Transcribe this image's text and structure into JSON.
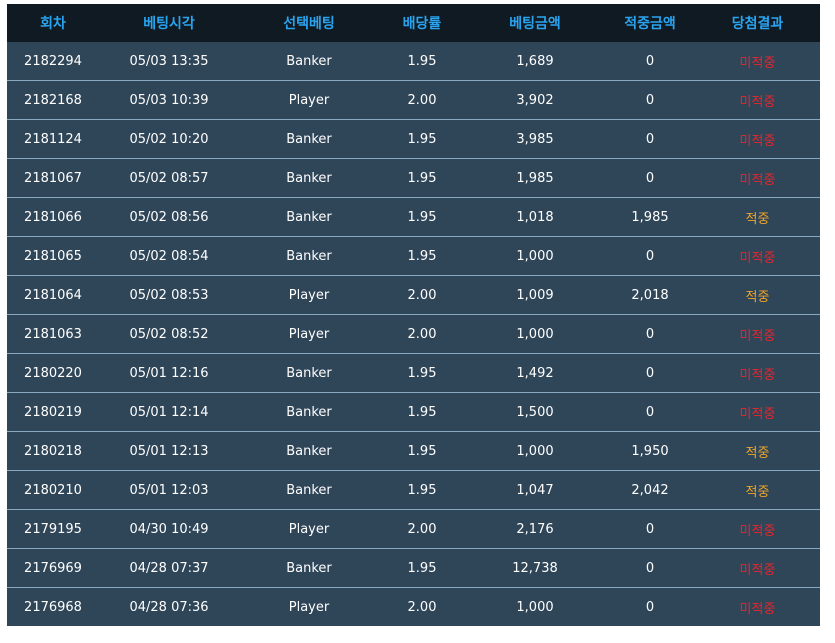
{
  "colors": {
    "header_bg": "#0f1a22",
    "header_text": "#2aa4f0",
    "row_bg": "#2f4558",
    "row_divider": "#88a8c0",
    "text": "#ffffff",
    "loss": "#e8262d",
    "win": "#f0a528"
  },
  "table": {
    "headers": [
      "회차",
      "베팅시각",
      "선택베팅",
      "배당률",
      "베팅금액",
      "적중금액",
      "당첨결과"
    ],
    "rows": [
      {
        "round": "2182294",
        "time": "05/03 13:35",
        "pick": "Banker",
        "odds": "1.95",
        "bet": "1,689",
        "win": "0",
        "result": "미적중",
        "status": "loss"
      },
      {
        "round": "2182168",
        "time": "05/03 10:39",
        "pick": "Player",
        "odds": "2.00",
        "bet": "3,902",
        "win": "0",
        "result": "미적중",
        "status": "loss"
      },
      {
        "round": "2181124",
        "time": "05/02 10:20",
        "pick": "Banker",
        "odds": "1.95",
        "bet": "3,985",
        "win": "0",
        "result": "미적중",
        "status": "loss"
      },
      {
        "round": "2181067",
        "time": "05/02 08:57",
        "pick": "Banker",
        "odds": "1.95",
        "bet": "1,985",
        "win": "0",
        "result": "미적중",
        "status": "loss"
      },
      {
        "round": "2181066",
        "time": "05/02 08:56",
        "pick": "Banker",
        "odds": "1.95",
        "bet": "1,018",
        "win": "1,985",
        "result": "적중",
        "status": "win"
      },
      {
        "round": "2181065",
        "time": "05/02 08:54",
        "pick": "Banker",
        "odds": "1.95",
        "bet": "1,000",
        "win": "0",
        "result": "미적중",
        "status": "loss"
      },
      {
        "round": "2181064",
        "time": "05/02 08:53",
        "pick": "Player",
        "odds": "2.00",
        "bet": "1,009",
        "win": "2,018",
        "result": "적중",
        "status": "win"
      },
      {
        "round": "2181063",
        "time": "05/02 08:52",
        "pick": "Player",
        "odds": "2.00",
        "bet": "1,000",
        "win": "0",
        "result": "미적중",
        "status": "loss"
      },
      {
        "round": "2180220",
        "time": "05/01 12:16",
        "pick": "Banker",
        "odds": "1.95",
        "bet": "1,492",
        "win": "0",
        "result": "미적중",
        "status": "loss"
      },
      {
        "round": "2180219",
        "time": "05/01 12:14",
        "pick": "Banker",
        "odds": "1.95",
        "bet": "1,500",
        "win": "0",
        "result": "미적중",
        "status": "loss"
      },
      {
        "round": "2180218",
        "time": "05/01 12:13",
        "pick": "Banker",
        "odds": "1.95",
        "bet": "1,000",
        "win": "1,950",
        "result": "적중",
        "status": "win"
      },
      {
        "round": "2180210",
        "time": "05/01 12:03",
        "pick": "Banker",
        "odds": "1.95",
        "bet": "1,047",
        "win": "2,042",
        "result": "적중",
        "status": "win"
      },
      {
        "round": "2179195",
        "time": "04/30 10:49",
        "pick": "Player",
        "odds": "2.00",
        "bet": "2,176",
        "win": "0",
        "result": "미적중",
        "status": "loss"
      },
      {
        "round": "2176969",
        "time": "04/28 07:37",
        "pick": "Banker",
        "odds": "1.95",
        "bet": "12,738",
        "win": "0",
        "result": "미적중",
        "status": "loss"
      },
      {
        "round": "2176968",
        "time": "04/28 07:36",
        "pick": "Player",
        "odds": "2.00",
        "bet": "1,000",
        "win": "0",
        "result": "미적중",
        "status": "loss"
      }
    ]
  }
}
